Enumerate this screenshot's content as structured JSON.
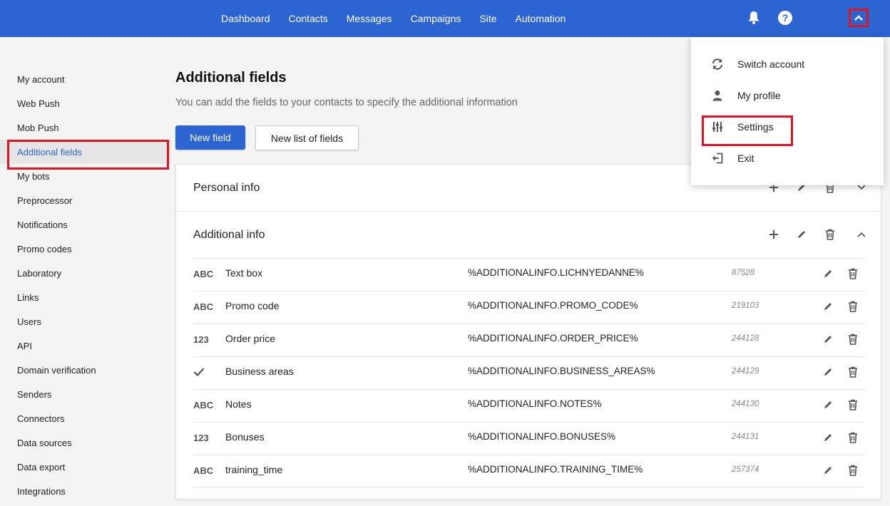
{
  "topnav": {
    "items": [
      "Dashboard",
      "Contacts",
      "Messages",
      "Campaigns",
      "Site",
      "Automation"
    ],
    "icons": [
      "bell-icon",
      "help-icon",
      "chevron-up-icon"
    ],
    "help_symbol": "?"
  },
  "sidebar": {
    "items": [
      "My account",
      "Web Push",
      "Mob Push",
      "Additional fields",
      "My bots",
      "Preprocessor",
      "Notifications",
      "Promo codes",
      "Laboratory",
      "Links",
      "Users",
      "API",
      "Domain verification",
      "Senders",
      "Connectors",
      "Data sources",
      "Data export",
      "Integrations"
    ],
    "active": "Additional fields"
  },
  "main": {
    "title": "Additional fields",
    "subtitle": "You can add the fields to your contacts to specify the additional information",
    "new_field_label": "New field",
    "new_list_label": "New list of fields"
  },
  "groups": [
    {
      "title": "Personal info",
      "expanded": false
    },
    {
      "title": "Additional info",
      "expanded": true
    }
  ],
  "fields": [
    {
      "type": "ABC",
      "name": "Text box",
      "variable": "%ADDITIONALINFO.LICHNYEDANNE%",
      "id": "87528"
    },
    {
      "type": "ABC",
      "name": "Promo code",
      "variable": "%ADDITIONALINFO.PROMO_CODE%",
      "id": "219103"
    },
    {
      "type": "123",
      "name": "Order price",
      "variable": "%ADDITIONALINFO.ORDER_PRICE%",
      "id": "244128"
    },
    {
      "type": "check",
      "name": "Business areas",
      "variable": "%ADDITIONALINFO.BUSINESS_AREAS%",
      "id": "244129"
    },
    {
      "type": "ABC",
      "name": "Notes",
      "variable": "%ADDITIONALINFO.NOTES%",
      "id": "244130"
    },
    {
      "type": "123",
      "name": "Bonuses",
      "variable": "%ADDITIONALINFO.BONUSES%",
      "id": "244131"
    },
    {
      "type": "ABC",
      "name": "training_time",
      "variable": "%ADDITIONALINFO.TRAINING_TIME%",
      "id": "257374"
    }
  ],
  "dropdown": {
    "items": [
      {
        "label": "Switch account",
        "icon": "sync-icon"
      },
      {
        "label": "My profile",
        "icon": "user-icon"
      },
      {
        "label": "Settings",
        "icon": "sliders-icon"
      },
      {
        "label": "Exit",
        "icon": "exit-icon"
      }
    ]
  },
  "colors": {
    "primary": "#2c64d2",
    "highlight": "#e0141e"
  }
}
